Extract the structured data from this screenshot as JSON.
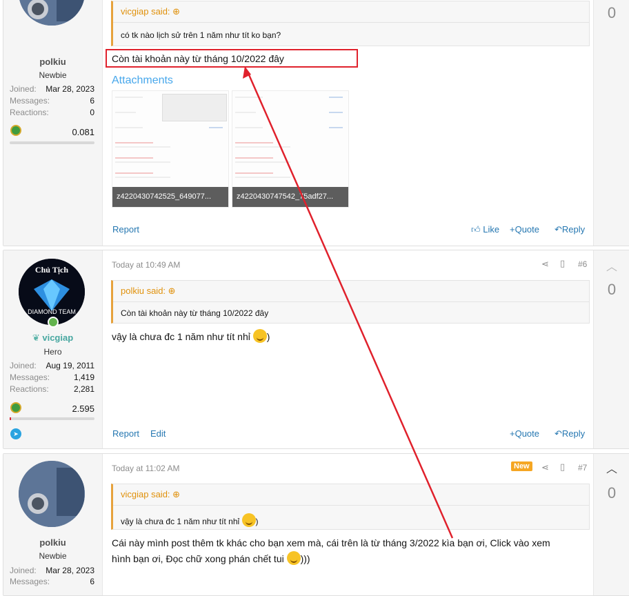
{
  "post1": {
    "username": "polkiu",
    "user_title": "Newbie",
    "stats": [
      {
        "key": "Joined:",
        "value": "Mar 28, 2023"
      },
      {
        "key": "Messages:",
        "value": "6"
      },
      {
        "key": "Reactions:",
        "value": "0"
      }
    ],
    "score": "0.081",
    "quote_author": "vicgiap said:",
    "quote_text": "có tk nào lịch sử trên 1 năm như tít ko bạn?",
    "message": "Còn tài khoản này từ tháng 10/2022 đây",
    "attachments_label": "Attachments",
    "attachments": [
      "z4220430742525_649077...",
      "z4220430747542_75adf27..."
    ],
    "report": "Report",
    "like": "Like",
    "quote_btn": "Quote",
    "reply": "Reply",
    "vote": "0"
  },
  "post2": {
    "avatar_text_top": "Chủ Tịch",
    "avatar_text_bottom": "DIAMOND TEAM",
    "username": "vicgiap",
    "user_title": "Hero",
    "stats": [
      {
        "key": "Joined:",
        "value": "Aug 19, 2011"
      },
      {
        "key": "Messages:",
        "value": "1,419"
      },
      {
        "key": "Reactions:",
        "value": "2,281"
      }
    ],
    "score": "2.595",
    "time": "Today at 10:49 AM",
    "post_num": "#6",
    "quote_author": "polkiu said:",
    "quote_text": "Còn tài khoản này từ tháng 10/2022 đây",
    "message": "vậy là chưa đc 1 năm như tít nhỉ",
    "message_tail": ")",
    "report": "Report",
    "edit": "Edit",
    "quote_btn": "Quote",
    "reply": "Reply",
    "vote": "0"
  },
  "post3": {
    "username": "polkiu",
    "user_title": "Newbie",
    "stats": [
      {
        "key": "Joined:",
        "value": "Mar 28, 2023"
      },
      {
        "key": "Messages:",
        "value": "6"
      }
    ],
    "time": "Today at 11:02 AM",
    "new_badge": "New",
    "post_num": "#7",
    "quote_author": "vicgiap said:",
    "quote_text": "vậy là chưa đc 1 năm như tít nhỉ",
    "quote_tail": ")",
    "message_line1": "Cái này mình post thêm tk khác cho bạn xem mà, cái trên là từ tháng 3/2022 kìa bạn ơi, Click vào xem",
    "message_line2": "hình bạn ơi, Đọc chữ xong phán chết tui",
    "message_tail": ")))",
    "vote": "0"
  },
  "colors": {
    "link": "#2577b1",
    "quote_accent": "#e6a23c",
    "annotation_red": "#e0212c",
    "header": "#1f4a78"
  },
  "icons": [
    "share-icon",
    "bookmark-icon",
    "thumbs-up-icon",
    "plus-icon",
    "reply-icon",
    "chevron-up-icon",
    "arrow-up-circle-icon",
    "telegram-icon",
    "trophy-medal-icon",
    "online-dot-icon",
    "hero-wings-icon"
  ]
}
